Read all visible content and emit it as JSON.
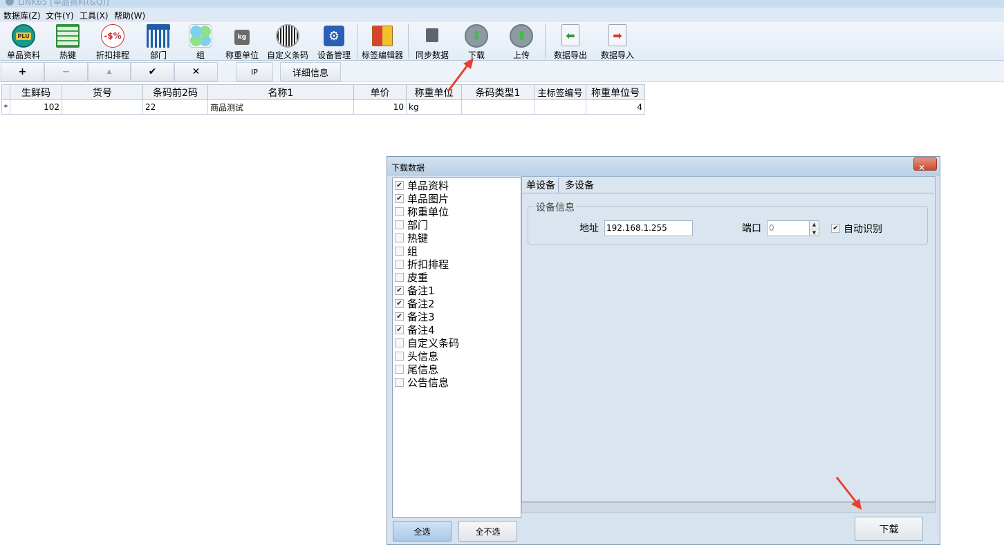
{
  "window": {
    "title": "LINK65 [单品资料(&Q)]"
  },
  "menu": [
    "数据库(Z)",
    "文件(Y)",
    "工具(X)",
    "帮助(W)"
  ],
  "toolbar": {
    "items": [
      {
        "label": "单品资料",
        "icon": "plu-icon",
        "badge": "PLU"
      },
      {
        "label": "热键",
        "icon": "hotkey-grid-icon"
      },
      {
        "label": "折扣排程",
        "icon": "discount-icon",
        "badge": "-$%"
      },
      {
        "label": "部门",
        "icon": "department-building-icon"
      },
      {
        "label": "组",
        "icon": "group-clover-icon"
      },
      {
        "label": "称重单位",
        "icon": "weight-kg-icon",
        "badge": "kg"
      },
      {
        "label": "自定义条码",
        "icon": "barcode-icon"
      },
      {
        "label": "设备管理",
        "icon": "device-settings-icon"
      },
      {
        "label": "标签编辑器",
        "icon": "label-editor-icon"
      },
      {
        "label": "同步数据",
        "icon": "sync-data-icon"
      },
      {
        "label": "下载",
        "icon": "download-arrow-icon"
      },
      {
        "label": "上传",
        "icon": "upload-arrow-icon"
      },
      {
        "label": "数据导出",
        "icon": "data-export-icon"
      },
      {
        "label": "数据导入",
        "icon": "data-import-icon"
      }
    ]
  },
  "navbar": {
    "add": "+",
    "remove": "−",
    "up": "▲",
    "confirm": "✔",
    "cancel": "✕",
    "ip": "IP",
    "details": "详细信息"
  },
  "grid": {
    "headers": [
      "生鲜码",
      "货号",
      "条码前2码",
      "名称1",
      "单价",
      "称重单位",
      "条码类型1",
      "主标签编号",
      "称重单位号"
    ],
    "rows": [
      {
        "indicator": "*",
        "cells": [
          "102",
          "",
          "22",
          "商品测试",
          "10",
          "kg",
          "",
          "",
          "4"
        ]
      }
    ]
  },
  "dialog": {
    "title": "下载数据",
    "close": "✕",
    "checklist": [
      {
        "label": "单品资料",
        "checked": true
      },
      {
        "label": "单品图片",
        "checked": true
      },
      {
        "label": "称重单位",
        "checked": false
      },
      {
        "label": "部门",
        "checked": false
      },
      {
        "label": "热键",
        "checked": false
      },
      {
        "label": "组",
        "checked": false
      },
      {
        "label": "折扣排程",
        "checked": false
      },
      {
        "label": "皮重",
        "checked": false
      },
      {
        "label": "备注1",
        "checked": true
      },
      {
        "label": "备注2",
        "checked": true
      },
      {
        "label": "备注3",
        "checked": true
      },
      {
        "label": "备注4",
        "checked": true
      },
      {
        "label": "自定义条码",
        "checked": false
      },
      {
        "label": "头信息",
        "checked": false
      },
      {
        "label": "尾信息",
        "checked": false
      },
      {
        "label": "公告信息",
        "checked": false
      }
    ],
    "tabs": [
      "单设备",
      "多设备"
    ],
    "group_title": "设备信息",
    "address_label": "地址",
    "address_value": "192.168.1.255",
    "port_label": "端口",
    "port_value": "0",
    "auto_label": "自动识别",
    "auto_checked": true,
    "select_all": "全选",
    "select_none": "全不选",
    "download_button": "下载"
  },
  "annotation_color": "#e8402e"
}
